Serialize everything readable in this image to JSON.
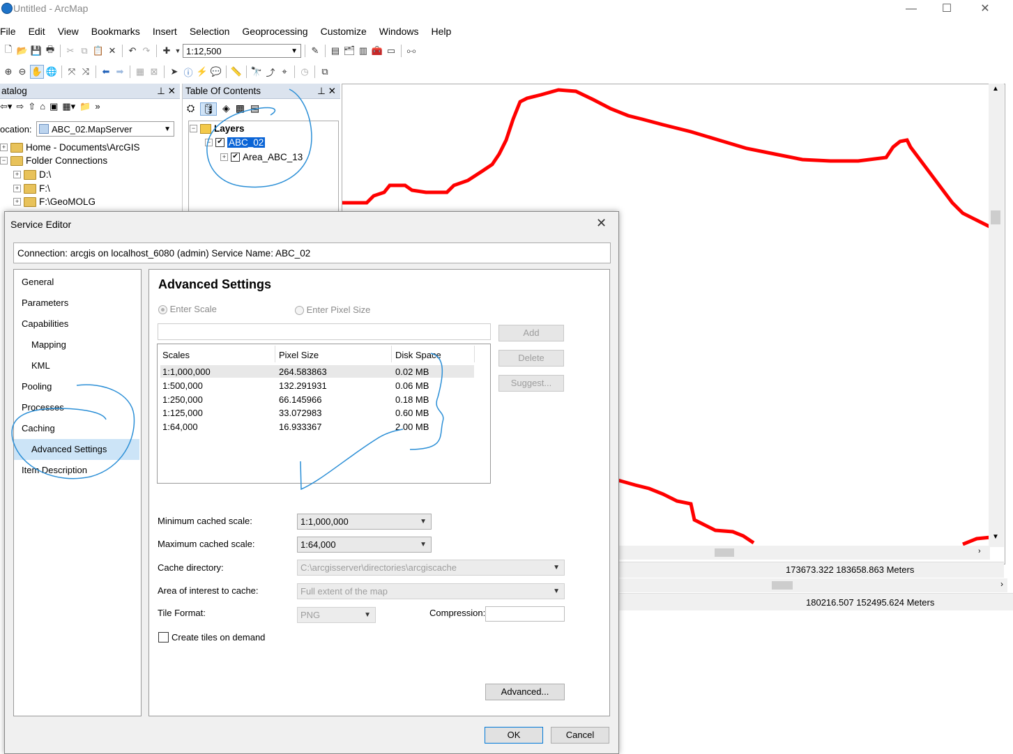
{
  "window": {
    "title": "Untitled - ArcMap",
    "controls": [
      "—",
      "☐",
      "✕"
    ]
  },
  "menu": [
    "File",
    "Edit",
    "View",
    "Bookmarks",
    "Insert",
    "Selection",
    "Geoprocessing",
    "Customize",
    "Windows",
    "Help"
  ],
  "toolbar": {
    "scale_value": "1:12,500"
  },
  "catalog": {
    "title": "atalog",
    "location_label": "ocation:",
    "location_value": "ABC_02.MapServer",
    "tree": [
      "Home - Documents\\ArcGIS",
      "Folder Connections",
      "D:\\",
      "F:\\",
      "F:\\GeoMOLG"
    ]
  },
  "toc": {
    "title": "Table Of Contents",
    "layers_label": "Layers",
    "service_layer": "ABC_02",
    "sublayer": "Area_ABC_13"
  },
  "map": {
    "coords_1": "173673.322  183658.863 Meters",
    "coords_2": "180216.507  152495.624 Meters",
    "line_color": "#ff0000"
  },
  "dialog": {
    "title": "Service Editor",
    "connection": "Connection: arcgis on localhost_6080 (admin)   Service Name: ABC_02",
    "nav": [
      "General",
      "Parameters",
      "Capabilities",
      "Mapping",
      "KML",
      "Pooling",
      "Processes",
      "Caching",
      "Advanced Settings",
      "Item Description"
    ],
    "selected_nav": "Advanced Settings",
    "heading": "Advanced Settings",
    "radio_scale": "Enter Scale",
    "radio_pixel": "Enter Pixel Size",
    "btn_add": "Add",
    "btn_delete": "Delete",
    "btn_suggest": "Suggest...",
    "table_headers": [
      "Scales",
      "Pixel Size",
      "Disk Space"
    ],
    "rows": [
      {
        "scale": "1:1,000,000",
        "pixel": "264.583863",
        "disk": "0.02 MB"
      },
      {
        "scale": "1:500,000",
        "pixel": "132.291931",
        "disk": "0.06 MB"
      },
      {
        "scale": "1:250,000",
        "pixel": "66.145966",
        "disk": "0.18 MB"
      },
      {
        "scale": "1:125,000",
        "pixel": "33.072983",
        "disk": "0.60 MB"
      },
      {
        "scale": "1:64,000",
        "pixel": "16.933367",
        "disk": "2.00 MB"
      }
    ],
    "min_scale_label": "Minimum cached scale:",
    "min_scale_value": "1:1,000,000",
    "max_scale_label": "Maximum cached scale:",
    "max_scale_value": "1:64,000",
    "cache_dir_label": "Cache directory:",
    "cache_dir_value": "C:\\arcgisserver\\directories\\arcgiscache",
    "aoi_label": "Area of interest to cache:",
    "aoi_value": "Full extent of the map",
    "tile_format_label": "Tile Format:",
    "tile_format_value": "PNG",
    "compression_label": "Compression:",
    "compression_value": "",
    "ondemand_label": "Create tiles on demand",
    "btn_advanced": "Advanced...",
    "btn_ok": "OK",
    "btn_cancel": "Cancel"
  }
}
